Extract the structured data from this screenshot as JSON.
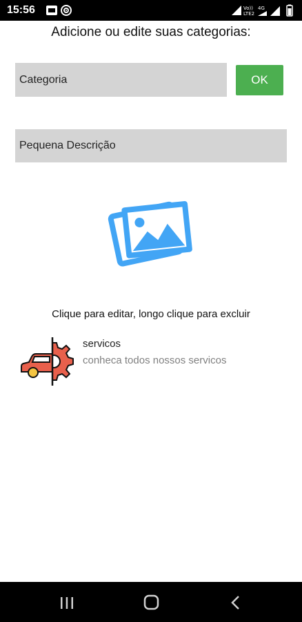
{
  "status_bar": {
    "time": "15:56",
    "left_icons": [
      "screenshot-icon",
      "rss-icon"
    ],
    "right_icons": [
      "signal-icon",
      "volte-icon",
      "4g-icon",
      "wifi-icon",
      "battery-icon"
    ],
    "volte_label": "Vo)) LTE2",
    "network_label": "4G"
  },
  "header": {
    "title": "Adicione ou edite suas categorias:"
  },
  "form": {
    "category_placeholder": "Categoria",
    "description_placeholder": "Pequena Descrição",
    "ok_label": "OK"
  },
  "image_picker": {
    "icon": "image-gallery-icon",
    "color": "#42a5f5"
  },
  "hint": "Clique para editar, longo clique para excluir",
  "categories": [
    {
      "title": "servicos",
      "description": "conheca todos nossos servicos",
      "icon": "car-gear-icon"
    }
  ],
  "nav_bar": {
    "buttons": [
      "recents-button",
      "home-button",
      "back-button"
    ]
  },
  "colors": {
    "accent_green": "#4caf50",
    "input_gray": "#d4d4d4",
    "icon_blue": "#42a5f5",
    "car_red": "#e8604c"
  }
}
